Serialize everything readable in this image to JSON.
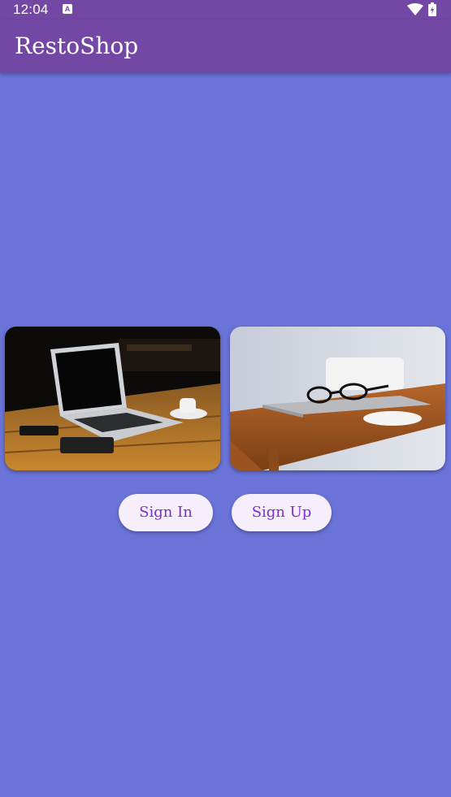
{
  "status_bar": {
    "time": "12:04",
    "notification_icon": "a-icon",
    "icons": [
      "wifi-icon",
      "battery-icon"
    ]
  },
  "app_bar": {
    "title": "RestoShop"
  },
  "images": [
    {
      "name": "laptop-on-wooden-table-image"
    },
    {
      "name": "glasses-on-laptop-image"
    }
  ],
  "buttons": {
    "sign_in": "Sign In",
    "sign_up": "Sign Up"
  },
  "colors": {
    "background": "#6a73d8",
    "app_bar": "#7348a4",
    "button_bg": "#f6eefb",
    "button_text": "#7b2fcf"
  }
}
